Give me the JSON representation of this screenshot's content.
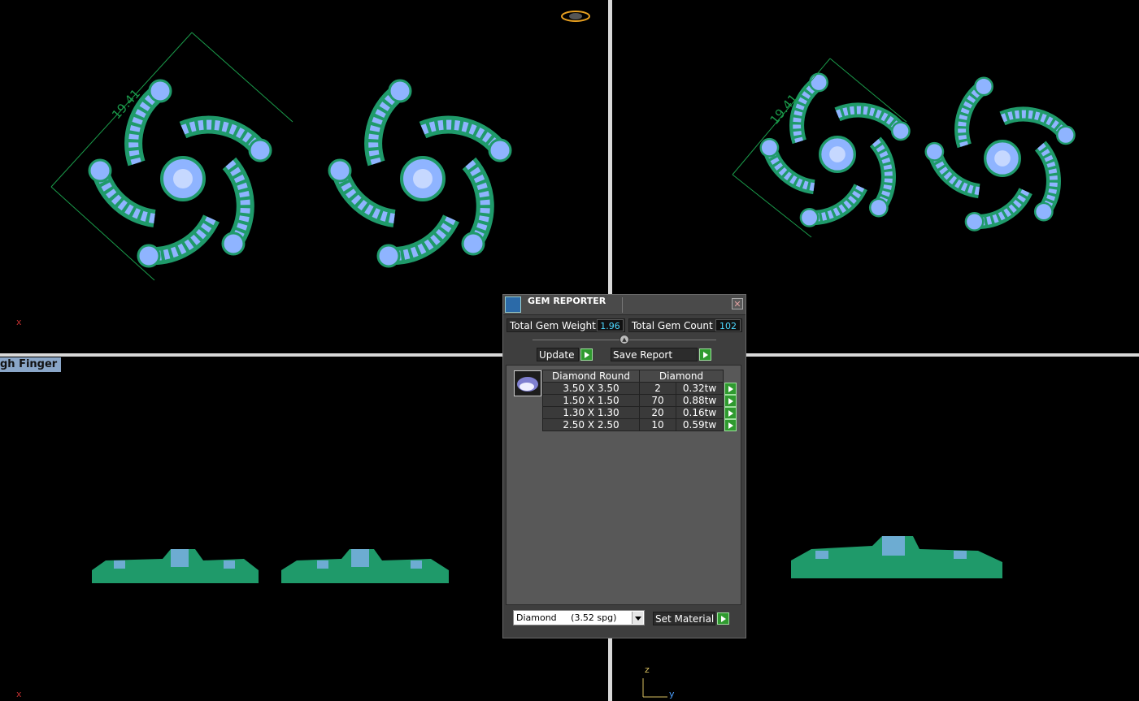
{
  "viewports": {
    "top_left": {
      "dimension": "19.41",
      "axis_label": "x"
    },
    "top_right": {
      "dimension": "19.41"
    },
    "bottom_left": {
      "label": "gh Finger",
      "axis_label": "x"
    },
    "bottom_right": {
      "axis_z": "z",
      "axis_y": "y"
    }
  },
  "gem_reporter": {
    "title": "GEM REPORTER",
    "close_glyph": "✕",
    "total_weight_label": "Total Gem Weight",
    "total_weight_value": "1.96",
    "total_count_label": "Total Gem Count",
    "total_count_value": "102",
    "update_label": "Update",
    "save_report_label": "Save Report",
    "table": {
      "header_shape": "Diamond Round",
      "header_material": "Diamond",
      "rows": [
        {
          "size": "3.50 X 3.50",
          "count": "2",
          "weight": "0.32tw"
        },
        {
          "size": "1.50 X 1.50",
          "count": "70",
          "weight": "0.88tw"
        },
        {
          "size": "1.30 X 1.30",
          "count": "20",
          "weight": "0.16tw"
        },
        {
          "size": "2.50 X 2.50",
          "count": "10",
          "weight": "0.59tw"
        }
      ]
    },
    "material_select": "Diamond     (3.52 spg)",
    "set_material_label": "Set Material"
  },
  "colors": {
    "metal": "#1f9a6a",
    "gem": "#8fb4ff",
    "dimension": "#1a9a4a",
    "value_text": "#4cd8ff"
  }
}
